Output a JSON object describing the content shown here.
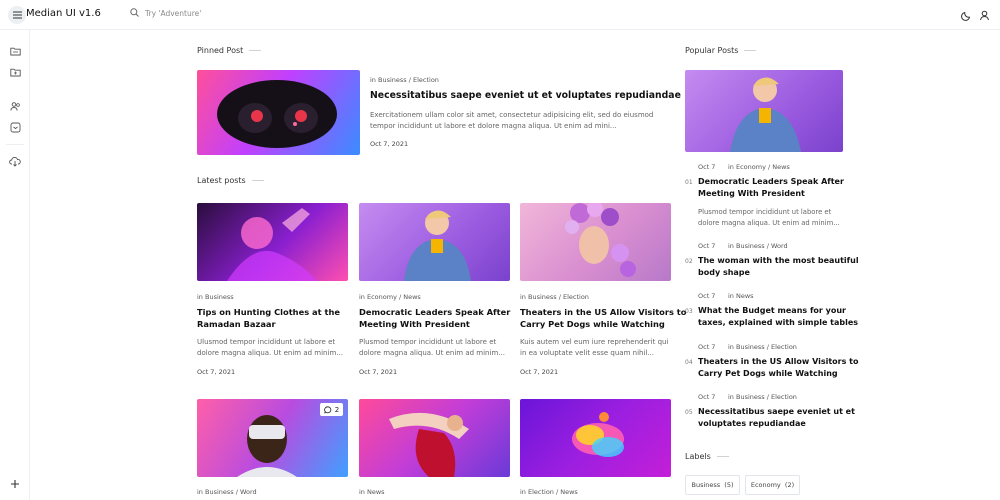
{
  "app": {
    "brand": "Median UI v1.6"
  },
  "search": {
    "placeholder": "Try 'Adventure'"
  },
  "pinned": {
    "heading": "Pinned Post",
    "category": "in Business / Election",
    "title": "Necessitatibus saepe eveniet ut et voluptates repudiandae",
    "excerpt1": "Exercitationem ullam color sit amet, consectetur adipisicing elit, sed do eiusmod",
    "excerpt2": "tempor incididunt ut labore et dolore magna aliqua. Ut enim ad mini...",
    "date": "Oct 7, 2021"
  },
  "latest": {
    "heading": "Latest posts",
    "posts": [
      {
        "category": "in Business",
        "title1": "Tips on Hunting Clothes at the",
        "title2": "Ramadan Bazaar",
        "excerpt1": "Ulusmod tempor incididunt ut labore et",
        "excerpt2": "dolore magna aliqua. Ut enim ad minim...",
        "date": "Oct 7, 2021"
      },
      {
        "category": "in Economy / News",
        "title1": "Democratic Leaders Speak After",
        "title2": "Meeting With President",
        "excerpt1": "Plusmod tempor incididunt ut labore et",
        "excerpt2": "dolore magna aliqua. Ut enim ad minim...",
        "date": "Oct 7, 2021"
      },
      {
        "category": "in Business / Election",
        "title1": "Theaters in the US Allow Visitors to",
        "title2": "Carry Pet Dogs while Watching",
        "excerpt1": "Kuis autem vel eum iure reprehenderit qui",
        "excerpt2": "in ea voluptate velit esse quam nihil...",
        "date": "Oct 7, 2021"
      },
      {
        "category": "in Business / Word",
        "comments": "2"
      },
      {
        "category": "in News"
      },
      {
        "category": "in Election / News"
      }
    ]
  },
  "popular": {
    "heading": "Popular Posts",
    "items": [
      {
        "date": "Oct 7",
        "category": "in Economy / News",
        "num": "01",
        "title1": "Democratic Leaders Speak After",
        "title2": "Meeting With President",
        "excerpt1": "Plusmod tempor incididunt ut labore et",
        "excerpt2": "dolore magna aliqua. Ut enim ad minim..."
      },
      {
        "date": "Oct 7",
        "category": "in Business / Word",
        "num": "02",
        "title1": "The woman with the most beautiful",
        "title2": "body shape"
      },
      {
        "date": "Oct 7",
        "category": "in News",
        "num": "03",
        "title1": "What the Budget means for your",
        "title2": "taxes, explained with simple tables"
      },
      {
        "date": "Oct 7",
        "category": "in Business / Election",
        "num": "04",
        "title1": "Theaters in the US Allow Visitors to",
        "title2": "Carry Pet Dogs while Watching"
      },
      {
        "date": "Oct 7",
        "category": "in Business / Election",
        "num": "05",
        "title1": "Necessitatibus saepe eveniet ut et",
        "title2": "voluptates repudiandae"
      }
    ]
  },
  "labels": {
    "heading": "Labels",
    "chips": [
      {
        "name": "Business",
        "count": "(5)"
      },
      {
        "name": "Economy",
        "count": "(2)"
      }
    ]
  },
  "colors": {
    "accent": "#8b5cf6",
    "border": "#eceff3"
  },
  "icons": [
    "menu-icon",
    "search-icon",
    "moon-icon",
    "user-icon",
    "folder-icon",
    "folder-plus-icon",
    "users-icon",
    "inbox-icon",
    "cloud-download-icon",
    "plus-icon",
    "comment-icon"
  ]
}
